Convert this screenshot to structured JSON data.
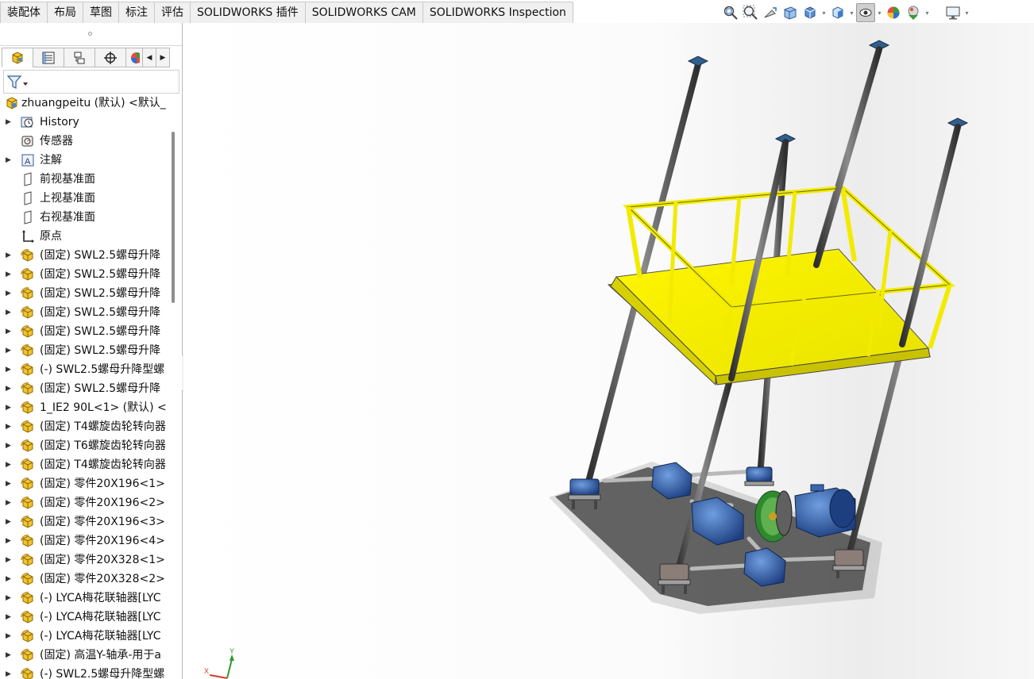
{
  "command_tabs": [
    "装配体",
    "布局",
    "草图",
    "标注",
    "评估",
    "SOLIDWORKS 插件",
    "SOLIDWORKS CAM",
    "SOLIDWORKS Inspection"
  ],
  "headsup_toolbar": [
    "zoom-to-fit-icon",
    "zoom-to-area-icon",
    "previous-view-icon",
    "section-view-icon",
    "view-orientation-icon",
    "display-style-icon",
    "hide-show-items-icon",
    "edit-appearance-icon",
    "apply-scene-icon",
    "view-settings-icon"
  ],
  "panel_tabs": [
    "featuremanager-tab-icon",
    "propertymanager-tab-icon",
    "configurationmanager-tab-icon",
    "dimxpert-tab-icon",
    "display-manager-tab-icon"
  ],
  "tree": {
    "root": "zhuangpeitu (默认) <默认_",
    "items": [
      {
        "label": "History",
        "icon": "history-icon",
        "expandable": true
      },
      {
        "label": "传感器",
        "icon": "sensor-icon",
        "expandable": false
      },
      {
        "label": "注解",
        "icon": "annotation-icon",
        "expandable": true
      },
      {
        "label": "前视基准面",
        "icon": "plane-icon",
        "expandable": false
      },
      {
        "label": "上视基准面",
        "icon": "plane-icon",
        "expandable": false
      },
      {
        "label": "右视基准面",
        "icon": "plane-icon",
        "expandable": false
      },
      {
        "label": "原点",
        "icon": "origin-icon",
        "expandable": false
      },
      {
        "label": "(固定) SWL2.5螺母升降",
        "icon": "subassembly-icon",
        "expandable": true
      },
      {
        "label": "(固定) SWL2.5螺母升降",
        "icon": "subassembly-icon",
        "expandable": true
      },
      {
        "label": "(固定) SWL2.5螺母升降",
        "icon": "subassembly-icon",
        "expandable": true
      },
      {
        "label": "(固定) SWL2.5螺母升降",
        "icon": "subassembly-icon",
        "expandable": true
      },
      {
        "label": "(固定) SWL2.5螺母升降",
        "icon": "subassembly-icon",
        "expandable": true
      },
      {
        "label": "(固定) SWL2.5螺母升降",
        "icon": "subassembly-icon",
        "expandable": true
      },
      {
        "label": "(-) SWL2.5螺母升降型螺",
        "icon": "subassembly-icon",
        "expandable": true
      },
      {
        "label": "(固定) SWL2.5螺母升降",
        "icon": "subassembly-icon",
        "expandable": true
      },
      {
        "label": "1_IE2 90L<1> (默认) <",
        "icon": "subassembly-icon",
        "expandable": true
      },
      {
        "label": "(固定) T4螺旋齿轮转向器",
        "icon": "subassembly-icon",
        "expandable": true
      },
      {
        "label": "(固定) T6螺旋齿轮转向器",
        "icon": "subassembly-icon",
        "expandable": true
      },
      {
        "label": "(固定) T4螺旋齿轮转向器",
        "icon": "subassembly-icon",
        "expandable": true
      },
      {
        "label": "(固定) 零件20X196<1>",
        "icon": "subassembly-icon",
        "expandable": true
      },
      {
        "label": "(固定) 零件20X196<2>",
        "icon": "subassembly-icon",
        "expandable": true
      },
      {
        "label": "(固定) 零件20X196<3>",
        "icon": "subassembly-icon",
        "expandable": true
      },
      {
        "label": "(固定) 零件20X196<4>",
        "icon": "subassembly-icon",
        "expandable": true
      },
      {
        "label": "(固定) 零件20X328<1>",
        "icon": "subassembly-icon",
        "expandable": true
      },
      {
        "label": "(固定) 零件20X328<2>",
        "icon": "subassembly-icon",
        "expandable": true
      },
      {
        "label": "(-) LYCA梅花联轴器[LYC",
        "icon": "subassembly-icon",
        "expandable": true
      },
      {
        "label": "(-) LYCA梅花联轴器[LYC",
        "icon": "subassembly-icon",
        "expandable": true
      },
      {
        "label": "(-) LYCA梅花联轴器[LYC",
        "icon": "subassembly-icon",
        "expandable": true
      },
      {
        "label": "(固定) 高温Y-轴承-用于a",
        "icon": "subassembly-icon",
        "expandable": true
      },
      {
        "label": "(-) SWL2.5螺母升降型螺",
        "icon": "subassembly-icon",
        "expandable": true
      }
    ]
  },
  "triad": {
    "x": "X",
    "y": "Y"
  },
  "colors": {
    "platform_yellow": "#f4f000",
    "rod_gray": "#4a4a4a",
    "gearbox_blue": "#2f5ba8",
    "coupling_green": "#3f9a3a"
  }
}
